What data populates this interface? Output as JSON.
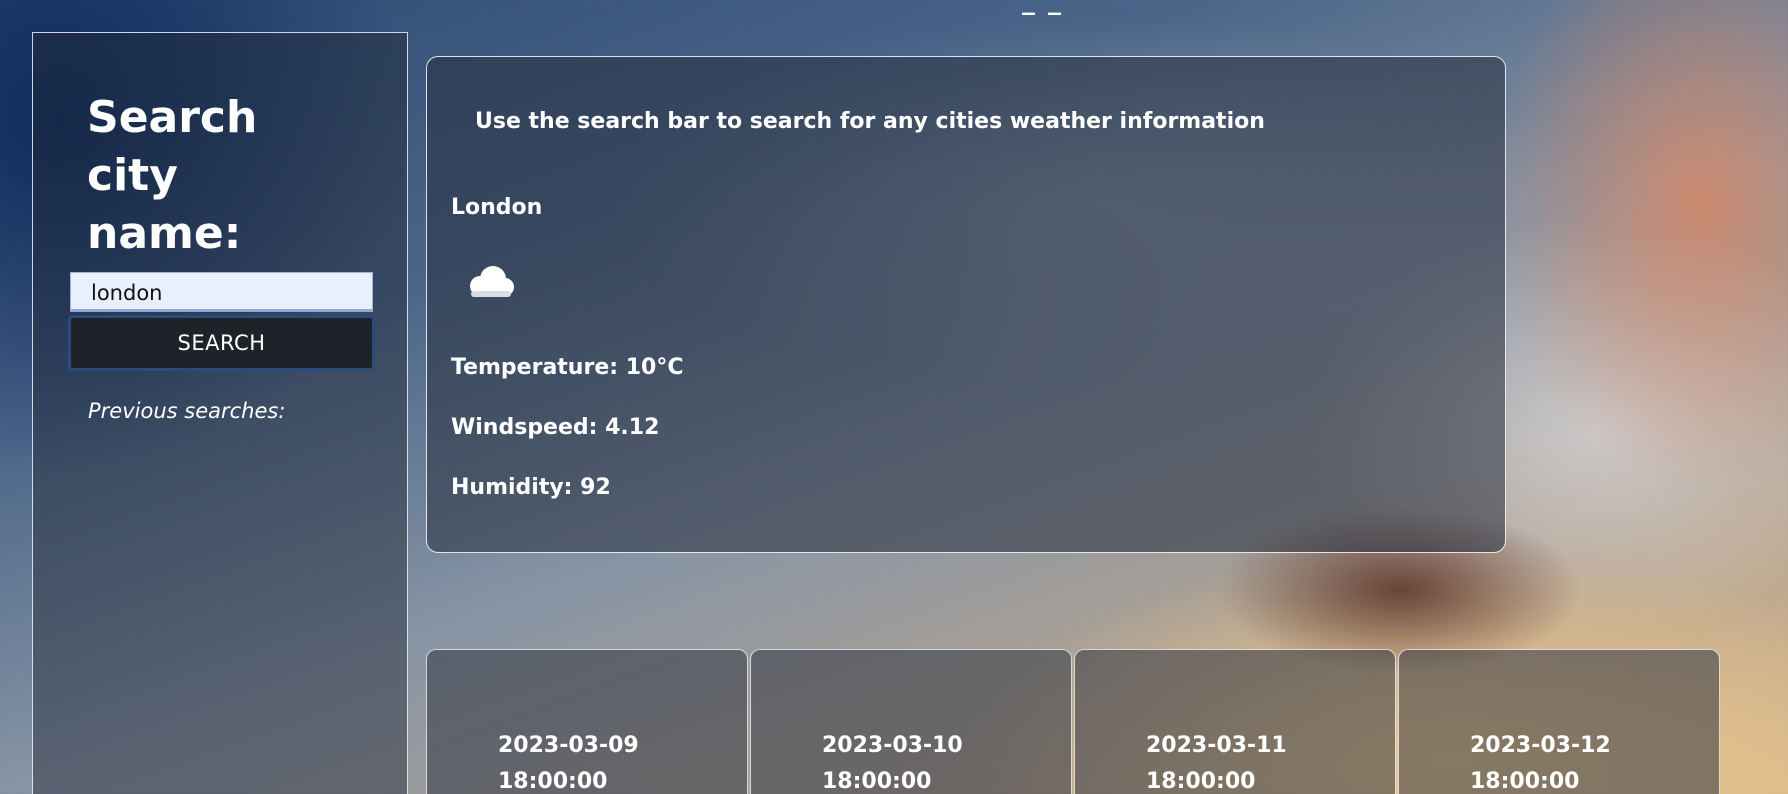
{
  "header": {
    "top_mark": "_ _"
  },
  "sidebar": {
    "title": "Search city name:",
    "search": {
      "value": "london"
    },
    "search_button_label": "SEARCH",
    "previous_label": "Previous searches:"
  },
  "current": {
    "intro": "Use the search bar to search for any cities weather information",
    "city": "London",
    "weather_icon": "cloud-icon",
    "temperature": "Temperature: 10°C",
    "windspeed": "Windspeed: 4.12",
    "humidity": "Humidity: 92"
  },
  "forecast": [
    {
      "date": "2023-03-09 18:00:00"
    },
    {
      "date": "2023-03-10 18:00:00"
    },
    {
      "date": "2023-03-11 18:00:00"
    },
    {
      "date": "2023-03-12 18:00:00"
    }
  ],
  "colors": {
    "button_bg": "#1f2329",
    "input_bg": "#e8f0fe",
    "text": "#ffffff"
  }
}
